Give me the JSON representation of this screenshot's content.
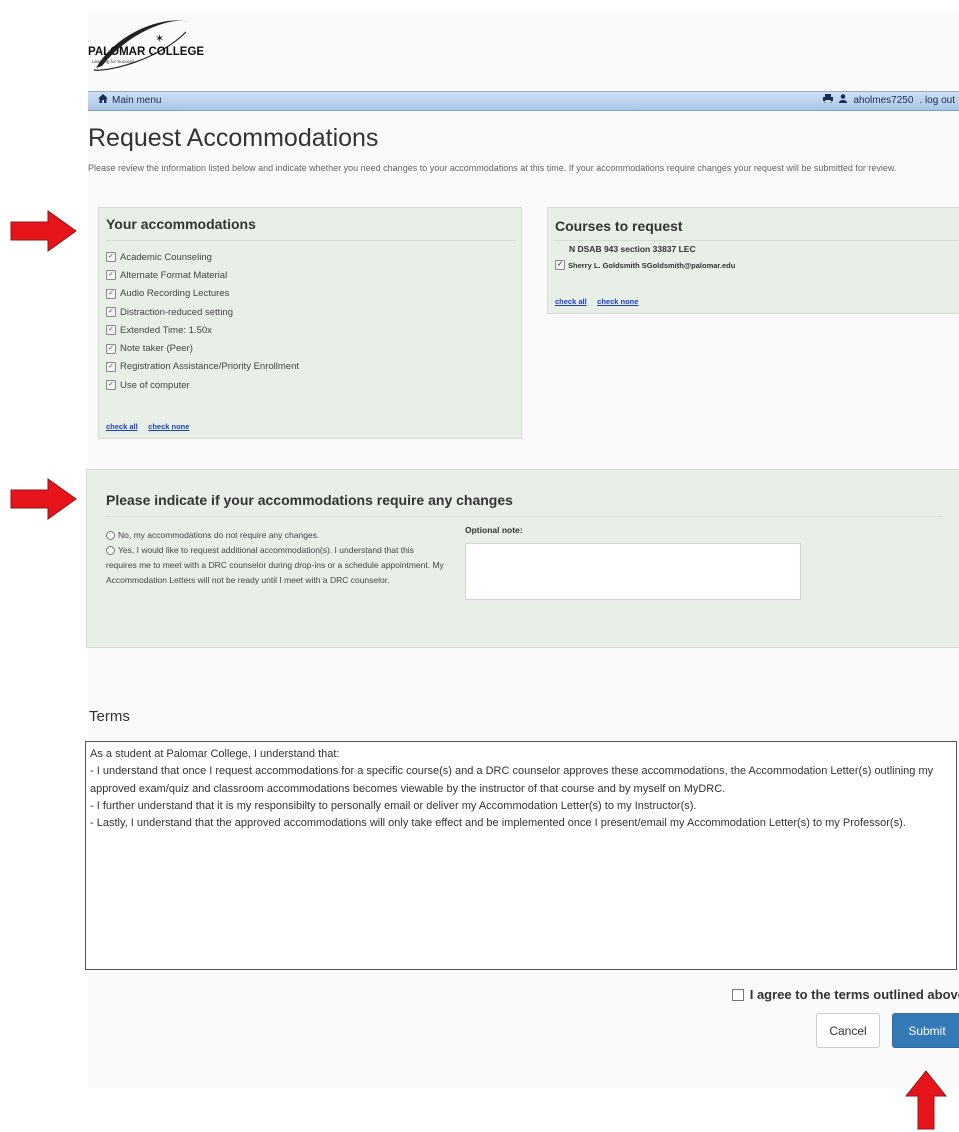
{
  "logo": {
    "name": "PALOMAR COLLEGE",
    "tagline": "Learning for Success"
  },
  "nav": {
    "main_menu": "Main menu",
    "username": "aholmes7250",
    "logout": ". log out"
  },
  "page": {
    "title": "Request Accommodations",
    "intro": "Please review the information listed below and indicate whether you need changes to your accommodations at this time. If your accommodations require changes your request will be submitted for review."
  },
  "accommodations": {
    "heading": "Your accommodations",
    "items": [
      "Academic Counseling",
      "Alternate Format Material",
      "Audio Recording Lectures",
      "Distraction-reduced setting",
      "Extended Time: 1.50x",
      "Note taker (Peer)",
      "Registration Assistance/Priority Enrollment",
      "Use of computer"
    ],
    "check_all": "check all",
    "check_none": "check none"
  },
  "courses": {
    "heading": "Courses to request",
    "course_title": "N DSAB 943 section 33837 LEC",
    "instructor": "Sherry L. Goldsmith SGoldsmith@palomar.edu",
    "check_all": "check all",
    "check_none": "check none"
  },
  "changes": {
    "heading": "Please indicate if your accommodations require any changes",
    "option_no": "No, my accommodations do not require any changes.",
    "option_yes": "Yes, I would like to request additional accommodation(s). I understand that this requires me to meet with a DRC counselor during drop-ins or a schedule appointment. My Accommodation Letters will not be ready until I meet with a DRC counselor.",
    "note_label": "Optional note:",
    "note_value": ""
  },
  "terms": {
    "label": "Terms",
    "lines": [
      "As a student at Palomar College, I understand that:",
      "- I understand that once I request accommodations for a specific course(s) and a DRC counselor approves these accommodations, the Accommodation Letter(s) outlining my approved exam/quiz and classroom accommodations becomes viewable by the instructor of that course and by myself on MyDRC.",
      "- I further understand that it is my responsibilty to personally email or deliver my Accommodation Letter(s) to my Instructor(s).",
      "- Lastly, I understand that the approved accommodations will only take effect and be implemented once I present/email my Accommodation Letter(s) to my Professor(s)."
    ],
    "agree_label": "I agree to the terms outlined above"
  },
  "buttons": {
    "cancel": "Cancel",
    "submit": "Submit"
  },
  "colors": {
    "annotation_arrow": "#e8141c",
    "submit": "#337ab7",
    "panel": "#e8efe7",
    "navbar": "#a9c6e6"
  }
}
